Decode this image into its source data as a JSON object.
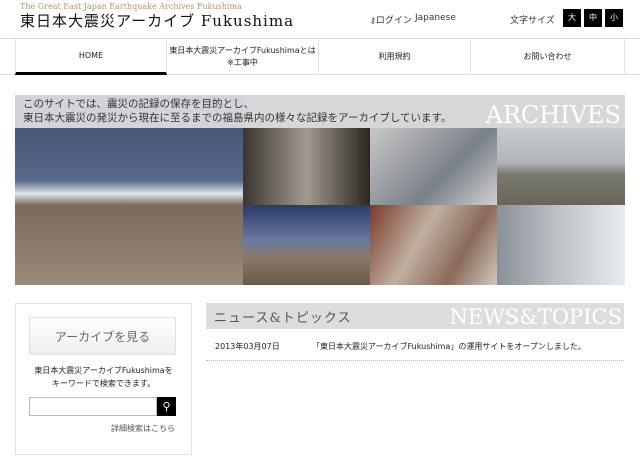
{
  "header": {
    "subtitle": "The Great East Japan Earthquake Archives Fukushima",
    "logo": "東日本大震災アーカイブ Fukushima",
    "login": "ログイン",
    "language": "Japanese",
    "font_size_label": "文字サイズ",
    "font_sizes": [
      "大",
      "中",
      "小"
    ]
  },
  "nav": [
    {
      "label": "HOME"
    },
    {
      "label": "東日本大震災アーカイブFukushimaとは",
      "label2": "※工事中"
    },
    {
      "label": "利用規約"
    },
    {
      "label": "お問い合わせ"
    }
  ],
  "hero": {
    "line1": "このサイトでは、震災の記録の保存を目的とし、",
    "line2": "東日本大震災の発災から現在に至るまでの福島県内の様々な記録をアーカイブしています。",
    "watermark": "ARCHIVES"
  },
  "sidebar": {
    "archive_button": "アーカイブを見る",
    "desc1": "東日本大震災アーカイブFukushimaを",
    "desc2": "キーワードで検索できます。",
    "search_placeholder": "",
    "advanced_link": "詳細検索はこちら"
  },
  "news": {
    "title": "ニュース&トピックス",
    "watermark": "NEWS&TOPICS",
    "items": [
      {
        "date": "2013年03月07日",
        "text": "「東日本大震災アーカイブFukushima」の運用サイトをオープンしました。"
      }
    ]
  }
}
